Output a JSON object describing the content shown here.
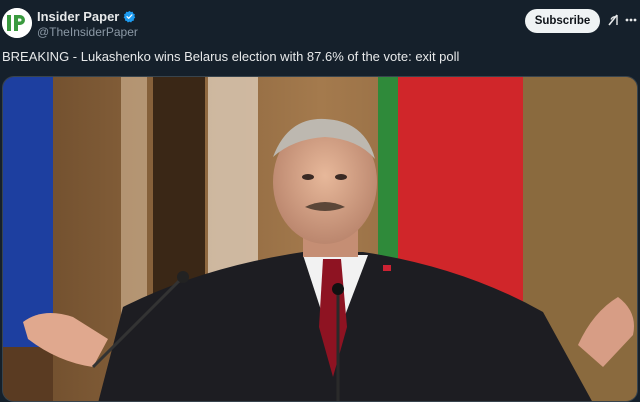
{
  "author": {
    "name": "Insider Paper",
    "handle": "@TheInsiderPaper",
    "avatar_text": "IP",
    "verified_icon": "verified-badge-icon"
  },
  "actions": {
    "subscribe_label": "Subscribe"
  },
  "tweet": {
    "text": "BREAKING - Lukashenko wins Belarus election with 87.6% of the vote: exit poll"
  },
  "colors": {
    "background": "#15202b",
    "verified": "#1d9bf0",
    "avatar_green": "#3a9a3f"
  }
}
